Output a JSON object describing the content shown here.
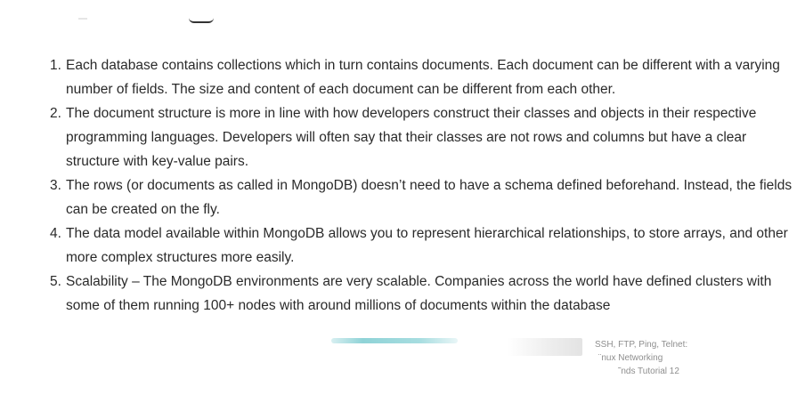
{
  "list": {
    "items": [
      {
        "number": "1.",
        "text": "Each database contains collections which in turn contains documents. Each document can be different with a varying number of fields. The size and content of each document can be different from each other."
      },
      {
        "number": "2.",
        "text": "The document structure is more in line with how developers construct their classes and objects in their respective programming languages. Developers will often say that their classes are not rows and columns but have a clear structure with key-value pairs."
      },
      {
        "number": "3.",
        "text": "The rows (or documents as called in MongoDB) doesn’t need to have a schema defined beforehand. Instead, the fields can be created on the fly."
      },
      {
        "number": "4.",
        "text": "The data model available within MongoDB allows you to represent hierarchical relationships, to store arrays, and other more complex structures more easily."
      },
      {
        "number": "5.",
        "text": "Scalability – The MongoDB environments are very scalable. Companies across the world have defined clusters with some of them running 100+ nodes with around millions of documents within the database"
      }
    ]
  },
  "related_thumbnail": {
    "caption_line_1": "SSH, FTP, Ping, Telnet:",
    "caption_line_2": "¨nux Networking",
    "caption_line_3": "˜nds Tutorial 12"
  },
  "colors": {
    "text": "#2a2a2a",
    "caption": "#8e8e8e",
    "accent_teal": "#8fd3d7"
  }
}
